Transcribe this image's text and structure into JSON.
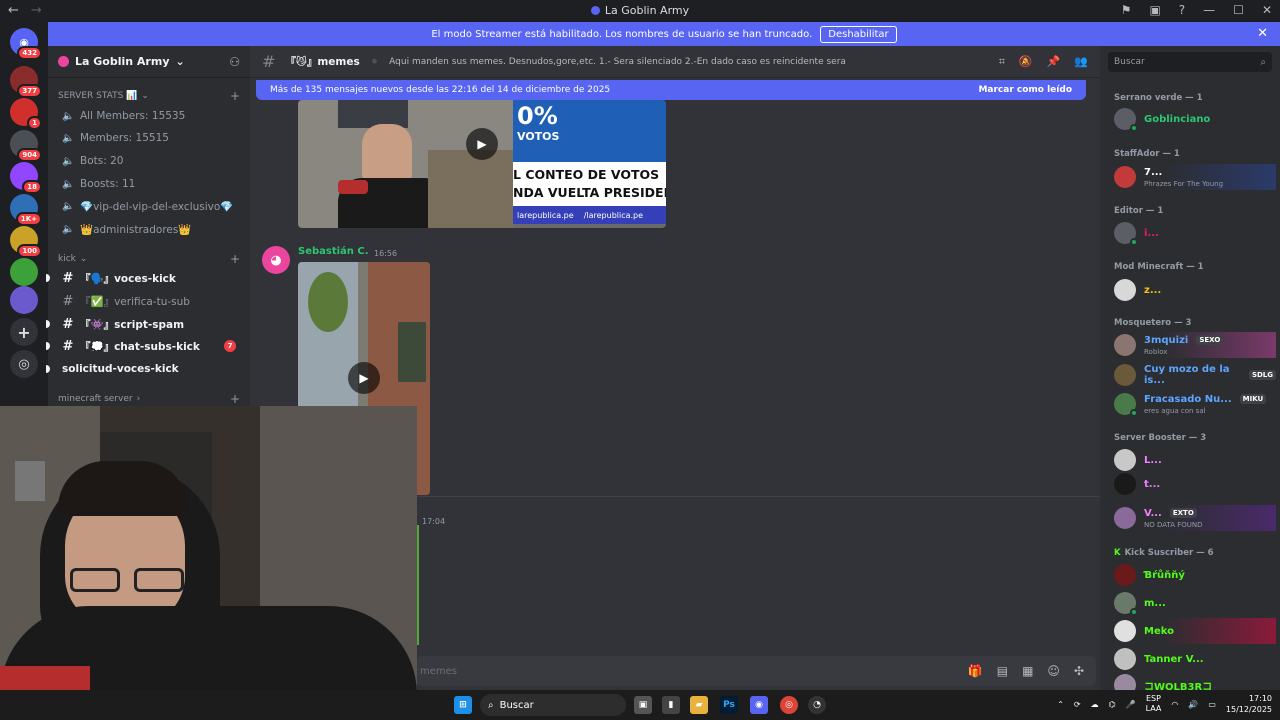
{
  "window": {
    "title": "La Goblin Army",
    "nav_back": "←",
    "nav_forward": "→",
    "controls": [
      "—",
      "☐",
      "✕"
    ]
  },
  "servers": [
    {
      "badge": "432",
      "color": "#5865f2"
    },
    {
      "badge": "377",
      "color": "#8b2c2c"
    },
    {
      "badge": "1",
      "color": "#d0302c"
    },
    {
      "badge": "904",
      "color": "#4a4e55"
    },
    {
      "badge": "18",
      "color": "#9146ff"
    },
    {
      "badge": "1K+",
      "color": "#2f6fb5"
    },
    {
      "badge": "100",
      "color": "#c9a227"
    },
    {
      "badge": "",
      "color": "#3ca13a"
    },
    {
      "badge": "",
      "color": "#6a5acd"
    }
  ],
  "banner": {
    "text": "El modo Streamer está habilitado. Los nombres de usuario se han truncado.",
    "button": "Deshabilitar",
    "close": "✕"
  },
  "sidebar": {
    "guild_name": "La Goblin Army",
    "categories": [
      {
        "label": "SERVER STATS 📊"
      },
      {
        "label": "kick"
      },
      {
        "label": "minecraft server"
      }
    ],
    "stats_channels": [
      {
        "label": "All Members: 15535"
      },
      {
        "label": "Members: 15515"
      },
      {
        "label": "Bots: 20"
      },
      {
        "label": "Boosts: 11"
      },
      {
        "label": "💎vip-del-vip-del-exclusivo💎"
      },
      {
        "label": "👑administradores👑"
      }
    ],
    "kick_channels": [
      {
        "label": "『🗣️』voces-kick",
        "bold": true
      },
      {
        "label": "『✅』verifica-tu-sub",
        "bold": false
      },
      {
        "label": "『👾』script-spam",
        "bold": true
      },
      {
        "label": "『💭』chat-subs-kick",
        "bold": true,
        "mentions": "7"
      },
      {
        "label": "solicitud-voces-kick",
        "bold": true
      }
    ]
  },
  "channel": {
    "name": "『😼』memes",
    "topic": "Aqui manden sus memes. Desnudos,gore,etc. 1.- Sera silenciado 2.-En dado caso es reincidente sera baneado",
    "new_messages": "Más de 135 mensajes nuevos desde las 22:16 del 14 de diciembre de 2025",
    "mark_read": "Marcar como leído",
    "composer_placeholder": "memes"
  },
  "messages": [
    {
      "author": "Sebastián C.",
      "time": "16:56"
    },
    {
      "author": "",
      "time": "17:04"
    }
  ],
  "video1": {
    "votos": "0% VOTOS",
    "line1": "L CONTEO DE VOTOS",
    "line2": "NDA VUELTA PRESIDEN",
    "handle1": "larepublica.pe",
    "handle2": "/larepublica.pe"
  },
  "members": {
    "search_placeholder": "Buscar",
    "groups": [
      {
        "label": "Serrano verde — 1",
        "members": [
          {
            "name": "Goblinciano",
            "color": "#2dc770"
          }
        ]
      },
      {
        "label": "StaffAdor — 1",
        "members": [
          {
            "name": "7...",
            "color": "#ffffff",
            "sub": "Phrazes For The Young"
          }
        ]
      },
      {
        "label": "Editor — 1",
        "members": [
          {
            "name": "i...",
            "color": "#e91e63"
          }
        ]
      },
      {
        "label": "Mod Minecraft — 1",
        "members": [
          {
            "name": "z...",
            "color": "#f1c40f"
          }
        ]
      },
      {
        "label": "Mosquetero — 3",
        "members": [
          {
            "name": "3mquizi",
            "color": "#5ea5ff",
            "tag": "SEXO",
            "sub": "Roblox"
          },
          {
            "name": "Cuy mozo de la is...",
            "color": "#5ea5ff",
            "tag": "SDLG"
          },
          {
            "name": "Fracasado Nu...",
            "color": "#5ea5ff",
            "tag": "MIKU",
            "sub": "eres agua con sal"
          }
        ]
      },
      {
        "label": "Server Booster — 3",
        "members": [
          {
            "name": "L...",
            "color": "#f47fff"
          },
          {
            "name": "t...",
            "color": "#f47fff"
          },
          {
            "name": "V...",
            "color": "#f47fff",
            "tag": "EXTO",
            "sub": "NO DATA FOUND"
          }
        ]
      },
      {
        "label": "Kick Suscriber — 6",
        "members": [
          {
            "name": "Ɓŕůňňý",
            "color": "#53fc18"
          },
          {
            "name": "m...",
            "color": "#53fc18"
          },
          {
            "name": "Meko",
            "color": "#53fc18"
          },
          {
            "name": "Tanner V...",
            "color": "#53fc18"
          },
          {
            "name": "コWOLB3Rコ",
            "color": "#53fc18"
          }
        ]
      }
    ]
  },
  "taskbar": {
    "search": "Buscar",
    "lang": "ESP",
    "lang2": "LAA",
    "time": "17:10",
    "date": "15/12/2025"
  }
}
